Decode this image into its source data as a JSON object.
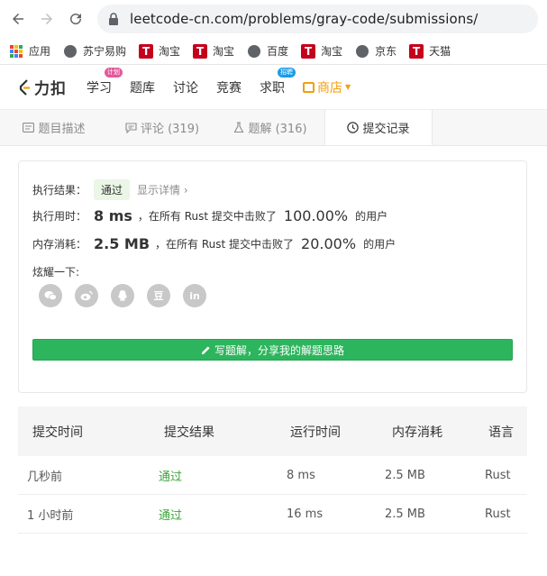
{
  "browser": {
    "url": "leetcode-cn.com/problems/gray-code/submissions/",
    "bookmarks": [
      {
        "label": "应用",
        "icon": "apps-icon"
      },
      {
        "label": "苏宁易购",
        "icon": "globe-icon"
      },
      {
        "label": "淘宝",
        "icon": "tmall-icon"
      },
      {
        "label": "淘宝",
        "icon": "tmall-icon"
      },
      {
        "label": "百度",
        "icon": "globe-icon"
      },
      {
        "label": "淘宝",
        "icon": "tmall-icon"
      },
      {
        "label": "京东",
        "icon": "globe-icon"
      },
      {
        "label": "天猫",
        "icon": "tmall-icon"
      }
    ]
  },
  "header": {
    "logo": "力扣",
    "nav": [
      {
        "label": "学习",
        "badge": "计划"
      },
      {
        "label": "题库",
        "badge": ""
      },
      {
        "label": "讨论",
        "badge": ""
      },
      {
        "label": "竞赛",
        "badge": ""
      },
      {
        "label": "求职",
        "badge": "招聘"
      }
    ],
    "shop": "商店",
    "colors": {
      "shop": "#f0a010",
      "badge_pink": "#e35a9a",
      "badge_blue": "#1a9be6"
    }
  },
  "tabs": [
    {
      "label": "题目描述",
      "icon": "description-icon"
    },
    {
      "label": "评论 (319)",
      "icon": "comment-icon"
    },
    {
      "label": "题解 (316)",
      "icon": "flask-icon"
    },
    {
      "label": "提交记录",
      "icon": "clock-icon",
      "active": true
    }
  ],
  "result": {
    "status_label": "执行结果：",
    "status": "通过",
    "details_link": "显示详情",
    "runtime_label": "执行用时：",
    "runtime": "8 ms",
    "runtime_mid": "，在所有 Rust 提交中击败了",
    "runtime_pct": "100.00%",
    "runtime_suffix": "的用户",
    "memory_label": "内存消耗：",
    "memory": "2.5 MB",
    "memory_mid": "，在所有 Rust 提交中击败了",
    "memory_pct": "20.00%",
    "memory_suffix": "的用户",
    "share_label": "炫耀一下:",
    "share_icons": [
      "wechat-icon",
      "weibo-icon",
      "qq-icon",
      "douban-icon",
      "linkedin-icon"
    ],
    "share_glyphs": {
      "douban": "豆",
      "linkedin": "in"
    },
    "write_button": "写题解，分享我的解题思路",
    "colors": {
      "pass_bg": "#eaf6e6",
      "button": "#2db55d"
    }
  },
  "submissions": {
    "headers": [
      "提交时间",
      "提交结果",
      "运行时间",
      "内存消耗",
      "语言"
    ],
    "rows": [
      {
        "time": "几秒前",
        "result": "通过",
        "runtime": "8 ms",
        "memory": "2.5 MB",
        "lang": "Rust"
      },
      {
        "time": "1 小时前",
        "result": "通过",
        "runtime": "16 ms",
        "memory": "2.5 MB",
        "lang": "Rust"
      }
    ],
    "colors": {
      "pass": "#3aa536"
    }
  }
}
